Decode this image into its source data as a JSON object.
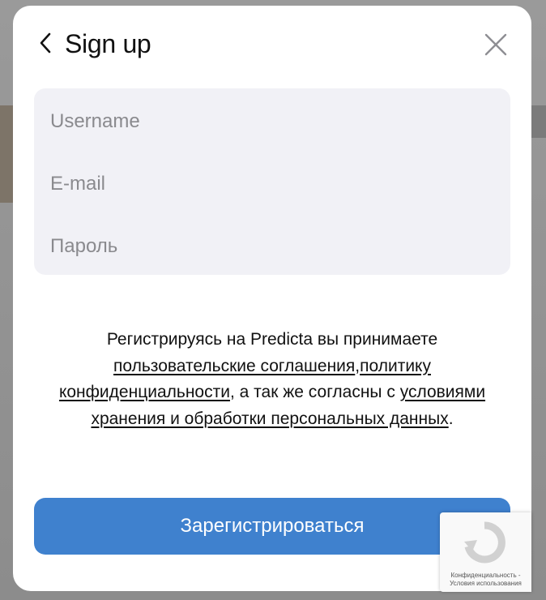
{
  "modal": {
    "title": "Sign up",
    "back_icon": "chevron-left-icon",
    "close_icon": "close-icon"
  },
  "form": {
    "username_placeholder": "Username",
    "email_placeholder": "E-mail",
    "password_placeholder": "Пароль"
  },
  "terms": {
    "intro": "Регистрируясь на Predicta вы принимаете ",
    "link_agreements": "пользовательские соглашения",
    "comma": ",",
    "link_privacy": "политику конфиденциальности",
    "middle": ", а так же согласны с ",
    "link_storage": "условиями хранения и обработки персональных данных",
    "end": "."
  },
  "submit_label": "Зарегистрироваться",
  "recaptcha": {
    "privacy": "Конфиденциальность",
    "separator": " - ",
    "terms": "Условия использования"
  },
  "colors": {
    "primary_button": "#3f81ce",
    "field_background": "#f1f1f6",
    "placeholder": "#8a8a8e"
  }
}
